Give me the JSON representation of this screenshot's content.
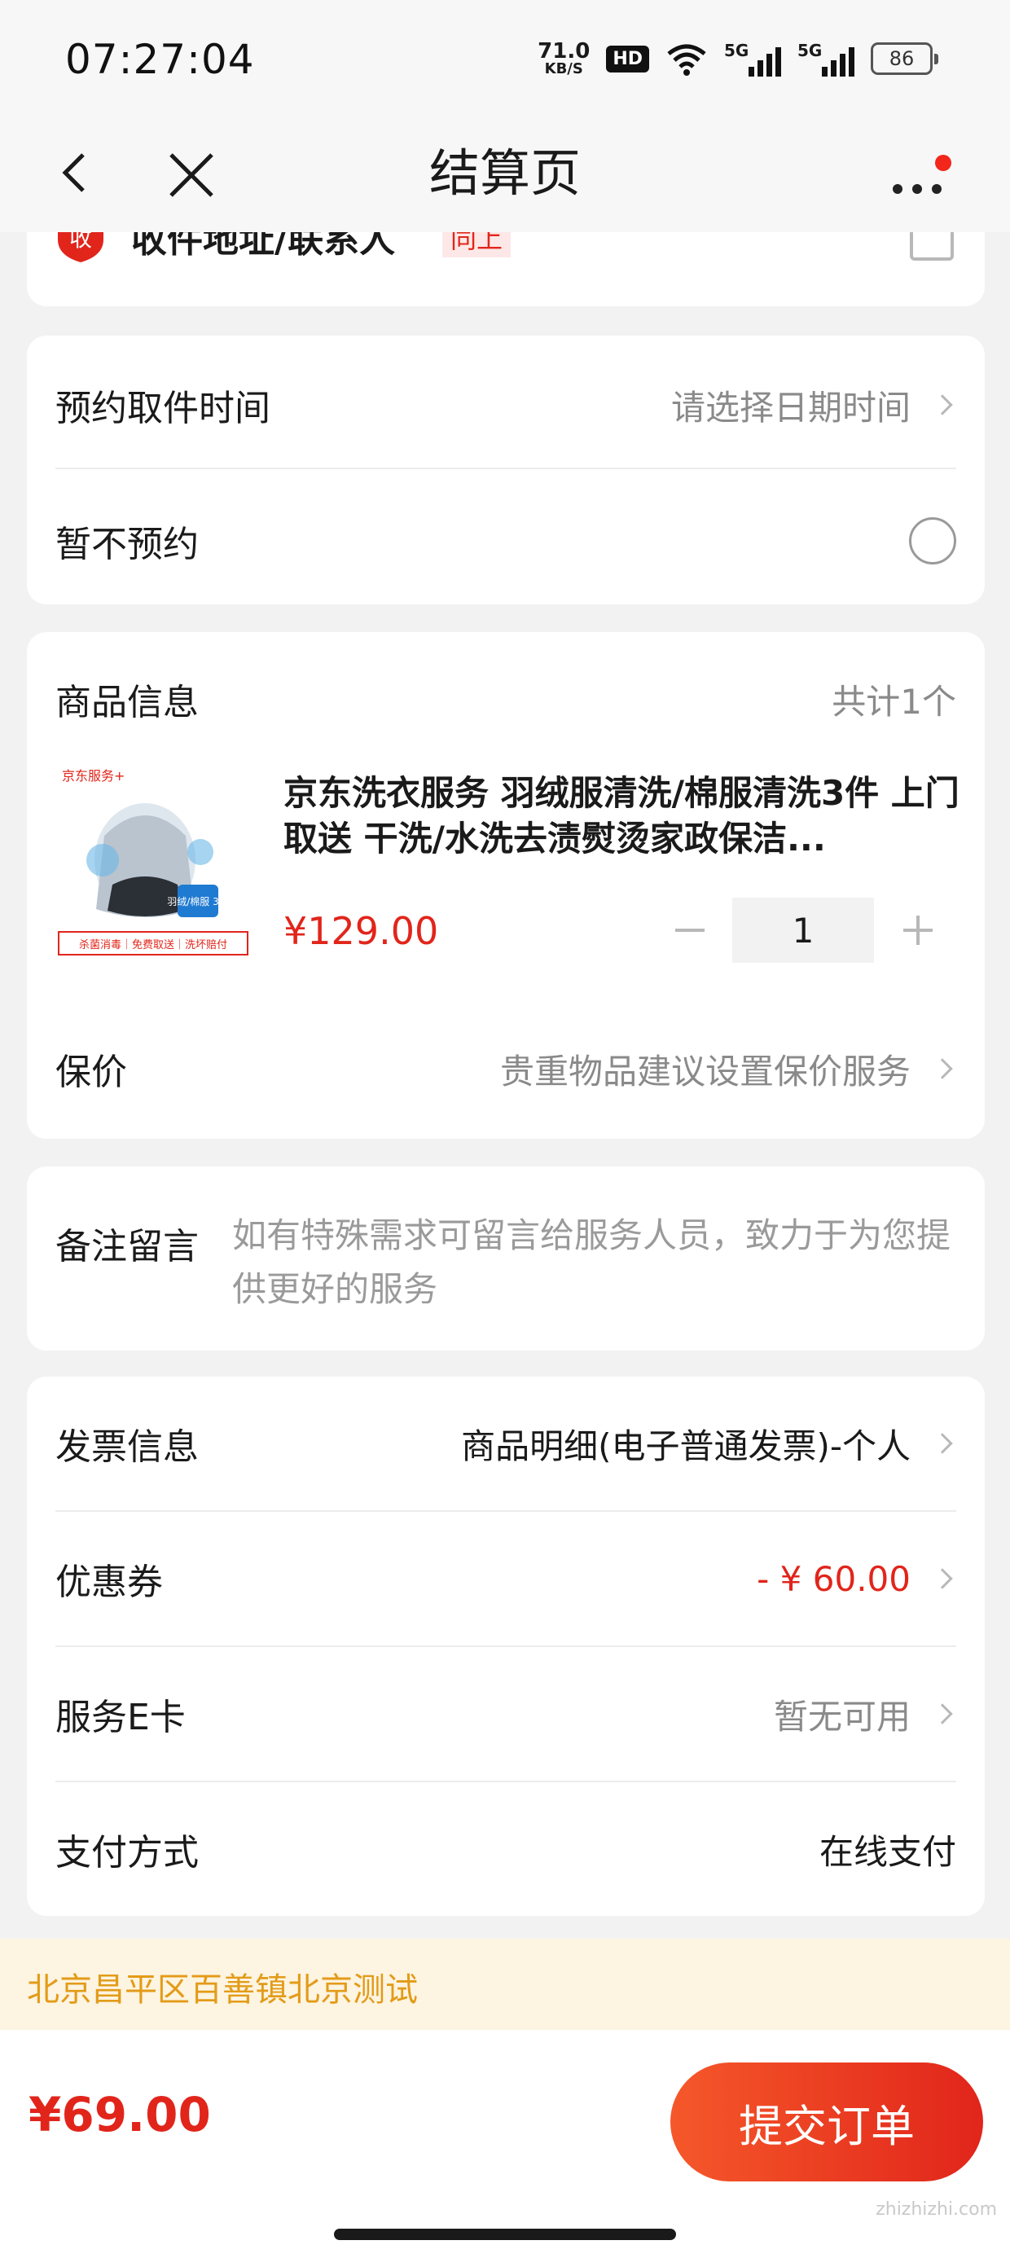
{
  "status_bar": {
    "time": "07:27:04",
    "net_speed_value": "71.0",
    "net_speed_unit": "KB/S",
    "hd_label": "HD",
    "signal1_label": "5G",
    "signal2_label": "5G",
    "battery": "86"
  },
  "nav": {
    "title": "结算页",
    "back_icon": "back-chevron-icon",
    "close_icon": "close-icon",
    "more_icon": "more-dots-icon"
  },
  "address": {
    "badge_label": "收",
    "text": "收件地址/联系人",
    "tag": "同上"
  },
  "pickup": {
    "time_label": "预约取件时间",
    "time_value": "请选择日期时间",
    "no_appointment_label": "暂不预约"
  },
  "product": {
    "section_label": "商品信息",
    "count": "共计1个",
    "image_brand": "京东服务+",
    "image_badge": "羽绒/棉服 3件",
    "image_tagline": "杀菌消毒｜免费取送｜洗坏赔付",
    "title": "京东洗衣服务 羽绒服清洗/棉服清洗3件 上门取送 干洗/水洗去渍熨烫家政保洁...",
    "price": "¥129.00",
    "quantity": "1",
    "insurance_label": "保价",
    "insurance_value": "贵重物品建议设置保价服务"
  },
  "note": {
    "label": "备注留言",
    "placeholder": "如有特殊需求可留言给服务人员，致力于为您提供更好的服务"
  },
  "payment": {
    "invoice_label": "发票信息",
    "invoice_value": "商品明细(电子普通发票)-个人",
    "coupon_label": "优惠券",
    "coupon_value": "- ¥ 60.00",
    "ecard_label": "服务E卡",
    "ecard_value": "暂无可用",
    "method_label": "支付方式",
    "method_value": "在线支付"
  },
  "address_strip": "北京昌平区百善镇北京测试",
  "bottom": {
    "total": "¥69.00",
    "submit_label": "提交订单"
  },
  "watermark": "zhizhizhi.com",
  "colors": {
    "accent_red": "#e1251b",
    "strip_bg": "#fdf4e1",
    "strip_text": "#e39b18"
  }
}
